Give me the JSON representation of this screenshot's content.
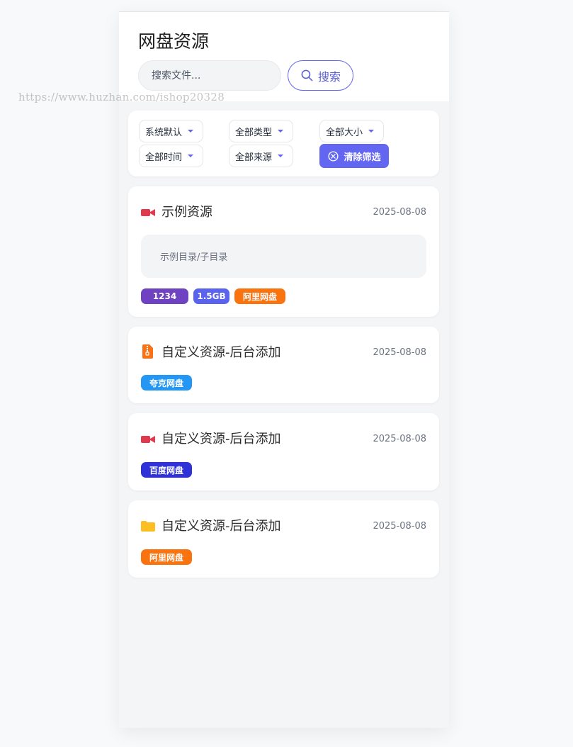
{
  "header": {
    "title": "网盘资源",
    "search_placeholder": "搜索文件...",
    "search_button": "搜索"
  },
  "watermark": "https://www.huzhan.com/ishop20328",
  "filters": {
    "sort": "系统默认",
    "type": "全部类型",
    "size": "全部大小",
    "time": "全部时间",
    "source": "全部来源",
    "clear_button": "清除筛选"
  },
  "colors": {
    "accent": "#6366f1",
    "video_icon": "#e0394f",
    "zip_icon": "#f97316",
    "folder_icon": "#fbbf24",
    "tag_count": "#6f42c1",
    "tag_size": "#5a63ee",
    "tag_aliyun": "#f9730f",
    "tag_quark": "#2496f3",
    "tag_baidu": "#2f32d6"
  },
  "resources": [
    {
      "icon": "video-icon",
      "title": "示例资源",
      "date": "2025-08-08",
      "path": "示例目录/子目录",
      "tags": [
        "1234",
        "1.5GB",
        "阿里网盘"
      ]
    },
    {
      "icon": "zip-file-icon",
      "title": "自定义资源-后台添加",
      "date": "2025-08-08",
      "tags": [
        "夸克网盘"
      ]
    },
    {
      "icon": "video-icon",
      "title": "自定义资源-后台添加",
      "date": "2025-08-08",
      "tags": [
        "百度网盘"
      ]
    },
    {
      "icon": "folder-icon",
      "title": "自定义资源-后台添加",
      "date": "2025-08-08",
      "tags": [
        "阿里网盘"
      ]
    }
  ]
}
